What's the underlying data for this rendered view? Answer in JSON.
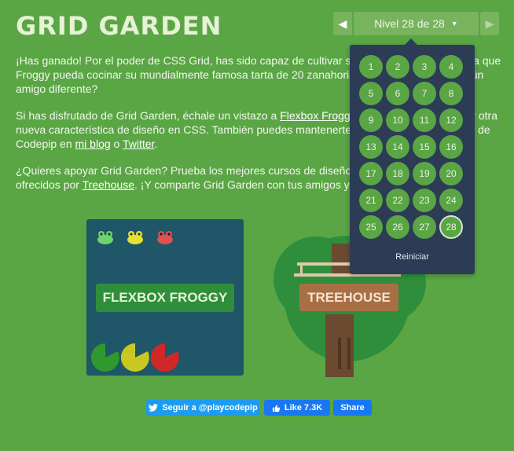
{
  "header": {
    "title": "GRID GARDEN"
  },
  "level_nav": {
    "prev_icon": "triangle-left-icon",
    "label": "Nivel 28 de 28",
    "caret_icon": "caret-down-icon",
    "next_icon": "triangle-right-icon"
  },
  "content": {
    "p1": "¡Has ganado! Por el poder de CSS Grid, has sido capaz de cultivar suficientes zanahorias para que Froggy pueda cocinar su mundialmente famosa tarta de 20 zanahorias. ¿Quieres invitar a algún amigo diferente?",
    "p2_a": "Si has disfrutado de Grid Garden, échale un vistazo a ",
    "p2_link1": "Flexbox Froggy",
    "p2_b": ", un juego para aprender otra nueva característica de diseño en CSS. También puedes mantenerte al día de otros proyectos de Codepip en ",
    "p2_link2": "mi blog",
    "p2_c": " o ",
    "p2_link3": "Twitter",
    "p2_d": ".",
    "p3_a": "¿Quieres apoyar Grid Garden? Prueba los mejores cursos de diseño web para principiantes ofrecidos por ",
    "p3_link": "Treehouse",
    "p3_b": ". ¡Y comparte Grid Garden con tus amigos y compañeros!"
  },
  "levels_menu": {
    "levels": [
      "1",
      "2",
      "3",
      "4",
      "5",
      "6",
      "7",
      "8",
      "9",
      "10",
      "11",
      "12",
      "13",
      "14",
      "15",
      "16",
      "17",
      "18",
      "19",
      "20",
      "21",
      "22",
      "23",
      "24",
      "25",
      "26",
      "27",
      "28"
    ],
    "current": "28",
    "reset_label": "Reiniciar"
  },
  "cards": {
    "froggy_label": "FLEXBOX FROGGY",
    "treehouse_label": "TREEHOUSE",
    "frog_colors": [
      "#6cd46c",
      "#e8e030",
      "#e05050"
    ],
    "pad_colors": [
      "#2e9a2e",
      "#c8c820",
      "#d02828"
    ]
  },
  "social": {
    "twitter_label": "Seguir a @playcodepip",
    "like_label": "Like 7.3K",
    "share_label": "Share"
  },
  "colors": {
    "background": "#5aa544",
    "menu_bg": "#2c3c55",
    "froggy_card": "#1f5668",
    "treehouse_button": "#a86f45"
  }
}
